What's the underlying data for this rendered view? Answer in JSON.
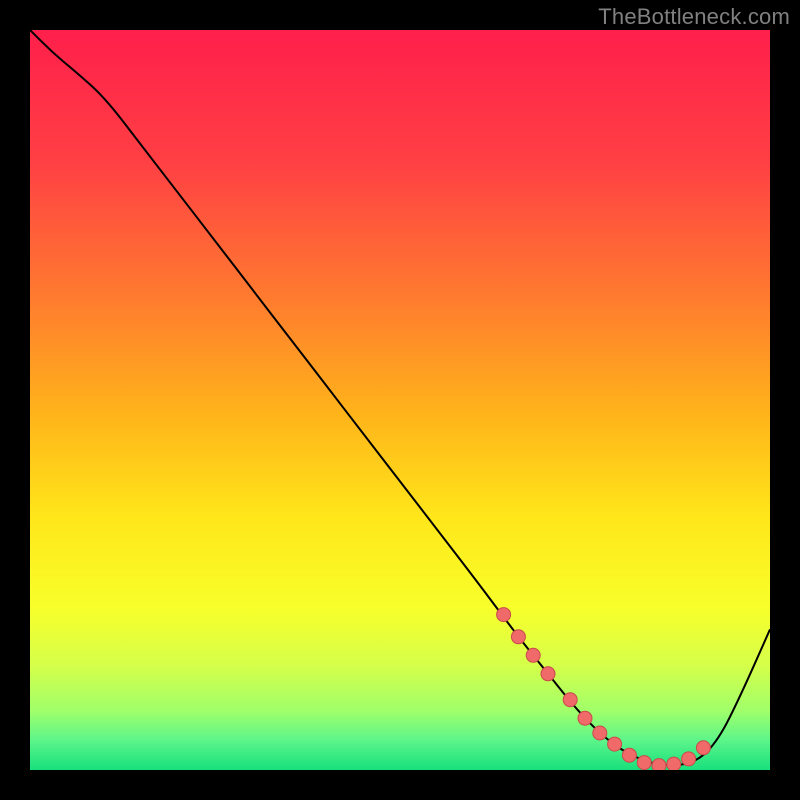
{
  "watermark": "TheBottleneck.com",
  "colors": {
    "frame": "#000000",
    "watermark": "#808080",
    "gradient_stops": [
      {
        "offset": 0.0,
        "color": "#ff1f4b"
      },
      {
        "offset": 0.18,
        "color": "#ff4044"
      },
      {
        "offset": 0.36,
        "color": "#ff7a2f"
      },
      {
        "offset": 0.52,
        "color": "#ffb41a"
      },
      {
        "offset": 0.66,
        "color": "#ffe71a"
      },
      {
        "offset": 0.78,
        "color": "#f8ff2a"
      },
      {
        "offset": 0.86,
        "color": "#d4ff4a"
      },
      {
        "offset": 0.92,
        "color": "#a0ff6a"
      },
      {
        "offset": 0.96,
        "color": "#5cf58a"
      },
      {
        "offset": 1.0,
        "color": "#17e07c"
      }
    ],
    "curve": "#000000",
    "marker_fill": "#f06a6a",
    "marker_stroke": "#c94a4a"
  },
  "chart_data": {
    "type": "line",
    "title": "",
    "xlabel": "",
    "ylabel": "",
    "xlim": [
      0,
      100
    ],
    "ylim": [
      0,
      100
    ],
    "grid": false,
    "legend": false,
    "series": [
      {
        "name": "bottleneck-curve",
        "x": [
          0,
          3,
          6,
          10,
          15,
          20,
          25,
          30,
          35,
          40,
          45,
          50,
          55,
          60,
          63,
          66,
          70,
          74,
          78,
          82,
          86,
          90,
          93,
          96,
          100
        ],
        "y": [
          100,
          97,
          94.5,
          91,
          84.5,
          78,
          71.5,
          65,
          58.5,
          52,
          45.5,
          39,
          32.5,
          26,
          22,
          18,
          13,
          8,
          4,
          1.5,
          0.5,
          1,
          4,
          10,
          19
        ]
      }
    ],
    "markers": {
      "name": "highlighted-points",
      "x": [
        64,
        66,
        68,
        70,
        73,
        75,
        77,
        79,
        81,
        83,
        85,
        87,
        89,
        91
      ],
      "y": [
        21,
        18,
        15.5,
        13,
        9.5,
        7,
        5,
        3.5,
        2,
        1,
        0.6,
        0.8,
        1.5,
        3
      ]
    }
  }
}
